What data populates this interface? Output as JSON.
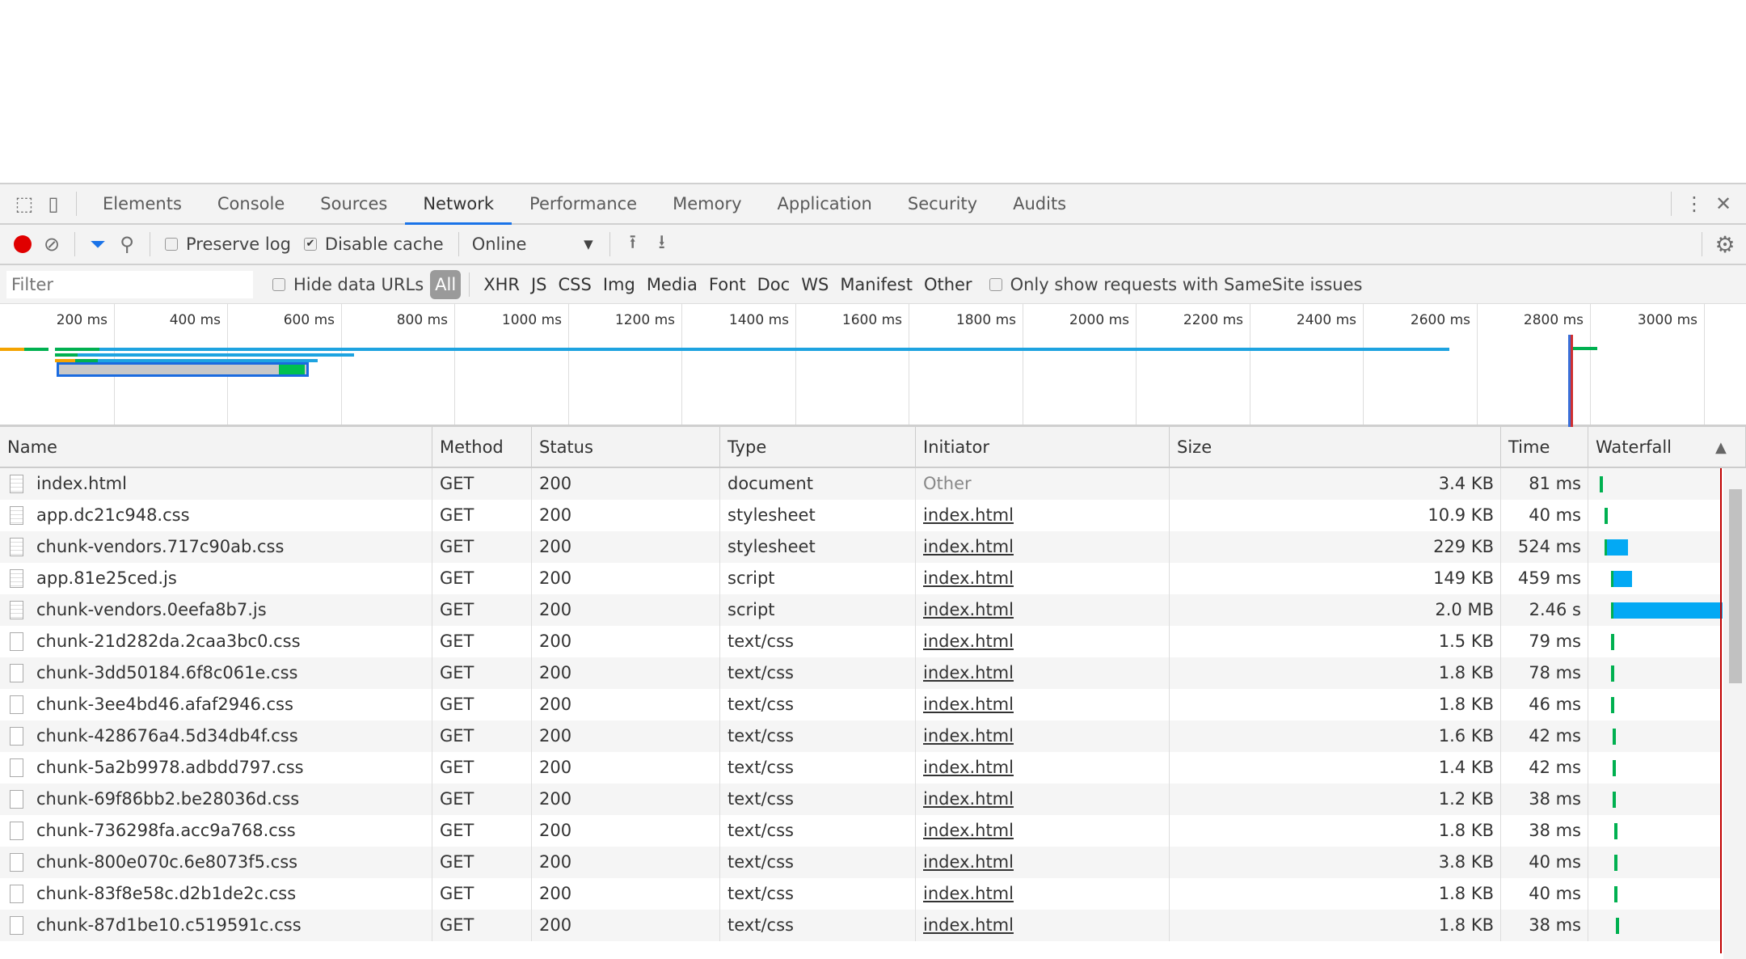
{
  "devtools": {
    "tabs": [
      "Elements",
      "Console",
      "Sources",
      "Network",
      "Performance",
      "Memory",
      "Application",
      "Security",
      "Audits"
    ],
    "active_tab": "Network",
    "toolbar": {
      "preserve_log": "Preserve log",
      "preserve_log_checked": false,
      "disable_cache": "Disable cache",
      "disable_cache_checked": true,
      "throttling": "Online"
    },
    "filter": {
      "placeholder": "Filter",
      "hide_data_urls": "Hide data URLs",
      "types": [
        "All",
        "XHR",
        "JS",
        "CSS",
        "Img",
        "Media",
        "Font",
        "Doc",
        "WS",
        "Manifest",
        "Other"
      ],
      "active_type": "All",
      "samesite": "Only show requests with SameSite issues"
    },
    "overview_ticks": [
      "200 ms",
      "400 ms",
      "600 ms",
      "800 ms",
      "1000 ms",
      "1200 ms",
      "1400 ms",
      "1600 ms",
      "1800 ms",
      "2000 ms",
      "2200 ms",
      "2400 ms",
      "2600 ms",
      "2800 ms",
      "3000 ms"
    ],
    "columns": [
      "Name",
      "Method",
      "Status",
      "Type",
      "Initiator",
      "Size",
      "Time",
      "Waterfall"
    ],
    "rows": [
      {
        "name": "index.html",
        "method": "GET",
        "status": "200",
        "type": "document",
        "initiator": "Other",
        "size": "3.4 KB",
        "time": "81 ms"
      },
      {
        "name": "app.dc21c948.css",
        "method": "GET",
        "status": "200",
        "type": "stylesheet",
        "initiator": "index.html",
        "size": "10.9 KB",
        "time": "40 ms"
      },
      {
        "name": "chunk-vendors.717c90ab.css",
        "method": "GET",
        "status": "200",
        "type": "stylesheet",
        "initiator": "index.html",
        "size": "229 KB",
        "time": "524 ms"
      },
      {
        "name": "app.81e25ced.js",
        "method": "GET",
        "status": "200",
        "type": "script",
        "initiator": "index.html",
        "size": "149 KB",
        "time": "459 ms"
      },
      {
        "name": "chunk-vendors.0eefa8b7.js",
        "method": "GET",
        "status": "200",
        "type": "script",
        "initiator": "index.html",
        "size": "2.0 MB",
        "time": "2.46 s"
      },
      {
        "name": "chunk-21d282da.2caa3bc0.css",
        "method": "GET",
        "status": "200",
        "type": "text/css",
        "initiator": "index.html",
        "size": "1.5 KB",
        "time": "79 ms"
      },
      {
        "name": "chunk-3dd50184.6f8c061e.css",
        "method": "GET",
        "status": "200",
        "type": "text/css",
        "initiator": "index.html",
        "size": "1.8 KB",
        "time": "78 ms"
      },
      {
        "name": "chunk-3ee4bd46.afaf2946.css",
        "method": "GET",
        "status": "200",
        "type": "text/css",
        "initiator": "index.html",
        "size": "1.8 KB",
        "time": "46 ms"
      },
      {
        "name": "chunk-428676a4.5d34db4f.css",
        "method": "GET",
        "status": "200",
        "type": "text/css",
        "initiator": "index.html",
        "size": "1.6 KB",
        "time": "42 ms"
      },
      {
        "name": "chunk-5a2b9978.adbdd797.css",
        "method": "GET",
        "status": "200",
        "type": "text/css",
        "initiator": "index.html",
        "size": "1.4 KB",
        "time": "42 ms"
      },
      {
        "name": "chunk-69f86bb2.be28036d.css",
        "method": "GET",
        "status": "200",
        "type": "text/css",
        "initiator": "index.html",
        "size": "1.2 KB",
        "time": "38 ms"
      },
      {
        "name": "chunk-736298fa.acc9a768.css",
        "method": "GET",
        "status": "200",
        "type": "text/css",
        "initiator": "index.html",
        "size": "1.8 KB",
        "time": "38 ms"
      },
      {
        "name": "chunk-800e070c.6e8073f5.css",
        "method": "GET",
        "status": "200",
        "type": "text/css",
        "initiator": "index.html",
        "size": "3.8 KB",
        "time": "40 ms"
      },
      {
        "name": "chunk-83f8e58c.d2b1de2c.css",
        "method": "GET",
        "status": "200",
        "type": "text/css",
        "initiator": "index.html",
        "size": "1.8 KB",
        "time": "40 ms"
      },
      {
        "name": "chunk-87d1be10.c519591c.css",
        "method": "GET",
        "status": "200",
        "type": "text/css",
        "initiator": "index.html",
        "size": "1.8 KB",
        "time": "38 ms"
      }
    ],
    "colors": {
      "accent": "#1a73e8",
      "record": "#e00000",
      "waiting": "#00b050",
      "download": "#03a9f4",
      "load_line": "#c00000"
    }
  }
}
